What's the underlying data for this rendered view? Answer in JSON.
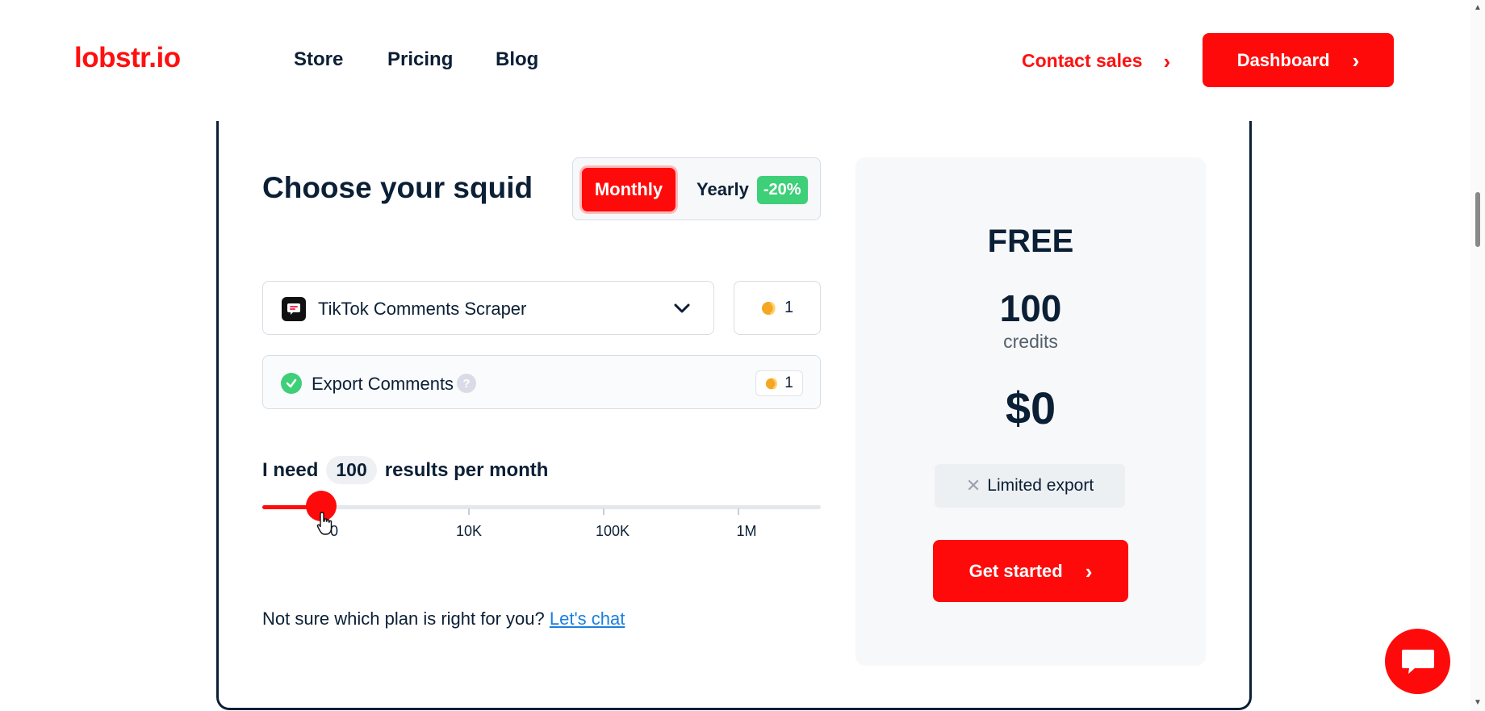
{
  "header": {
    "logo": "lobstr.io",
    "nav": [
      "Store",
      "Pricing",
      "Blog"
    ],
    "contact_sales": "Contact sales",
    "dashboard": "Dashboard"
  },
  "pricing": {
    "title": "Choose your squid",
    "billing": {
      "monthly": "Monthly",
      "yearly": "Yearly",
      "yearly_discount": "-20%",
      "selected": "Monthly"
    },
    "scraper": {
      "selected": "TikTok Comments Scraper",
      "credit_cost": "1"
    },
    "export": {
      "label": "Export Comments",
      "help": "?",
      "credit_cost": "1",
      "enabled": true
    },
    "need": {
      "prefix": "I need",
      "value": "100",
      "suffix": "results per month"
    },
    "slider": {
      "ticks": [
        "0",
        "10K",
        "100K",
        "1M"
      ],
      "level": 0.106
    },
    "help_text": "Not sure which plan is right for you?",
    "help_link": "Let's chat"
  },
  "plan": {
    "name": "FREE",
    "credits": "100",
    "credits_label": "credits",
    "price": "$0",
    "feature": "Limited export",
    "cta": "Get started"
  },
  "colors": {
    "brand_red": "#ff0a0a",
    "navy": "#0b1f35",
    "green": "#3ecf79",
    "link_blue": "#1a7fe0"
  },
  "icons": [
    "chevron-right-icon",
    "chevron-down-icon",
    "tiktok-comment-icon",
    "coin-icon",
    "check-icon",
    "help-icon",
    "close-icon",
    "pointer-cursor-icon",
    "chat-icon"
  ]
}
